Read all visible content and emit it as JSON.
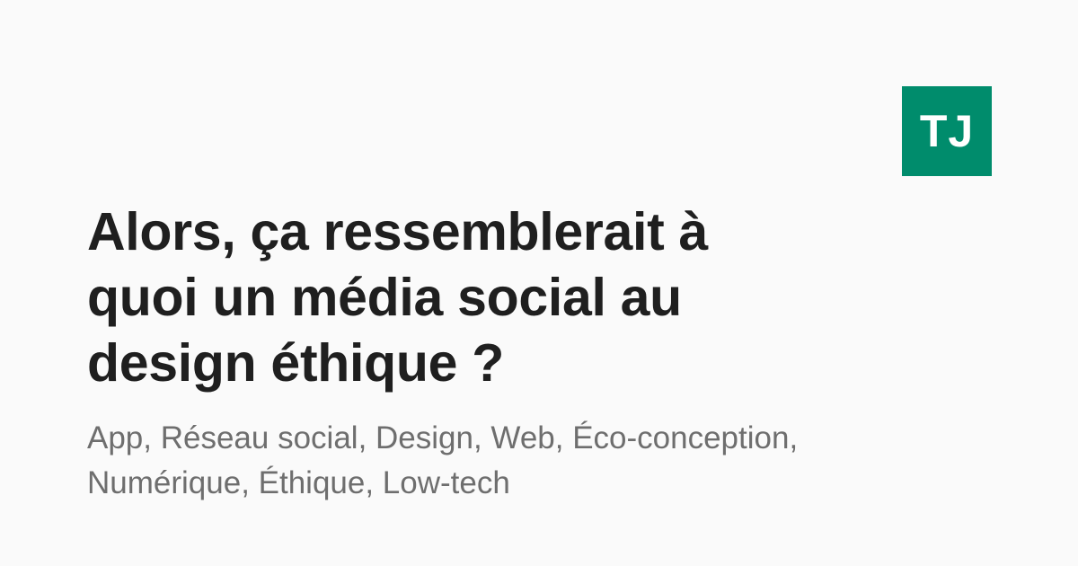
{
  "logo": {
    "text": "TJ",
    "background_color": "#008c6c",
    "text_color": "#ffffff"
  },
  "article": {
    "title": "Alors, ça ressemblerait à quoi un média social au design éthique ?",
    "tags": "App, Réseau social, Design, Web, Éco-conception, Numérique, Éthique, Low-tech"
  },
  "colors": {
    "background": "#fafafa",
    "title": "#1f1f1f",
    "tags": "#6e6e6e"
  }
}
